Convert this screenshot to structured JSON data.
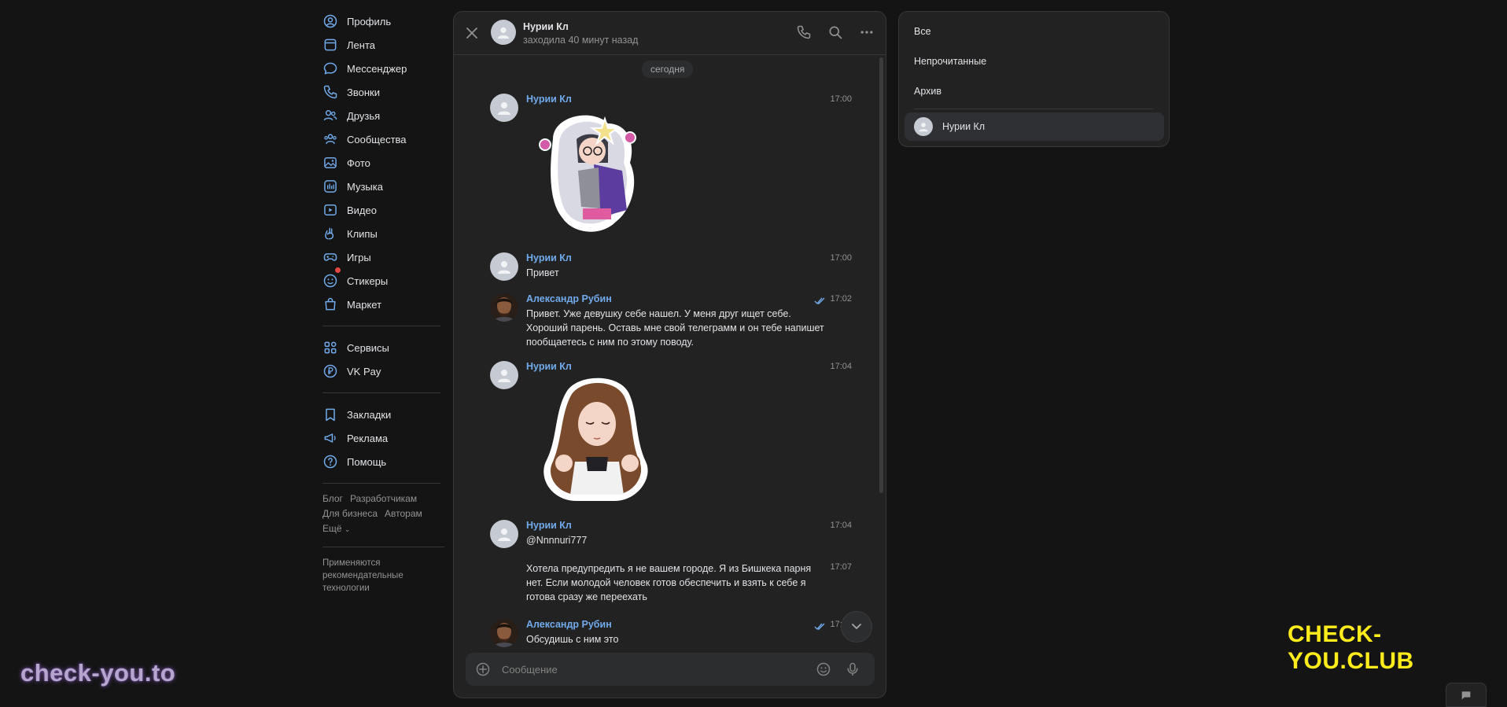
{
  "nav": {
    "items": [
      {
        "label": "Профиль",
        "icon": "user-circle-icon"
      },
      {
        "label": "Лента",
        "icon": "newsfeed-icon"
      },
      {
        "label": "Мессенджер",
        "icon": "message-icon"
      },
      {
        "label": "Звонки",
        "icon": "phone-icon"
      },
      {
        "label": "Друзья",
        "icon": "friends-icon"
      },
      {
        "label": "Сообщества",
        "icon": "communities-icon"
      },
      {
        "label": "Фото",
        "icon": "photo-icon"
      },
      {
        "label": "Музыка",
        "icon": "music-icon"
      },
      {
        "label": "Видео",
        "icon": "video-icon"
      },
      {
        "label": "Клипы",
        "icon": "clips-icon"
      },
      {
        "label": "Игры",
        "icon": "gamepad-icon"
      },
      {
        "label": "Стикеры",
        "icon": "sticker-icon"
      },
      {
        "label": "Маркет",
        "icon": "bag-icon"
      }
    ],
    "items2": [
      {
        "label": "Сервисы",
        "icon": "grid-icon"
      },
      {
        "label": "VK Pay",
        "icon": "ruble-icon"
      }
    ],
    "items3": [
      {
        "label": "Закладки",
        "icon": "bookmark-icon"
      },
      {
        "label": "Реклама",
        "icon": "megaphone-icon"
      },
      {
        "label": "Помощь",
        "icon": "help-icon"
      }
    ],
    "footer": {
      "blog": "Блог",
      "developers": "Разработчикам",
      "business": "Для бизнеса",
      "authors": "Авторам",
      "more": "Ещё"
    },
    "note": "Применяются рекомендательные технологии"
  },
  "chat": {
    "header": {
      "name": "Нурии Кл",
      "status": "заходила 40 минут назад"
    },
    "date_label": "сегодня",
    "messages": [
      {
        "author": "Нурии Кл",
        "time": "17:00",
        "sticker": "anime-girl-glasses-sticker"
      },
      {
        "author": "Нурии Кл",
        "time": "17:00",
        "text": "Привет"
      },
      {
        "author": "Александр Рубин",
        "time": "17:02",
        "text": "Привет. Уже девушку себе нашел. У меня друг ищет себе. Хороший парень. Оставь мне свой телеграмм и он тебе напишет пообщаетесь с ним по этому поводу."
      },
      {
        "author": "Нурии Кл",
        "time": "17:04",
        "sticker": "anime-girl-meditating-sticker"
      },
      {
        "author": "Нурии Кл",
        "time": "17:04",
        "text": "@Nnnnuri777"
      },
      {
        "author": "",
        "time": "17:07",
        "text": "Хотела предупредить я не вашем городе. Я из Бишкека парня нет. Если молодой человек готов обеспечить и взять к себе я готова сразу же переехать"
      },
      {
        "author": "Александр Рубин",
        "time": "17:07",
        "text": "Обсудишь с ним это"
      }
    ],
    "input_placeholder": "Сообщение"
  },
  "filters": {
    "all": "Все",
    "unread": "Непрочитанные",
    "archive": "Архив",
    "chat_item": "Нурии Кл"
  },
  "watermarks": {
    "left": "check-you.to",
    "right": "CHECK-YOU.CLUB"
  },
  "colors": {
    "accent_link": "#71aaeb",
    "background": "#141414",
    "panel": "#222222",
    "watermark_yellow": "#ffec1a"
  }
}
